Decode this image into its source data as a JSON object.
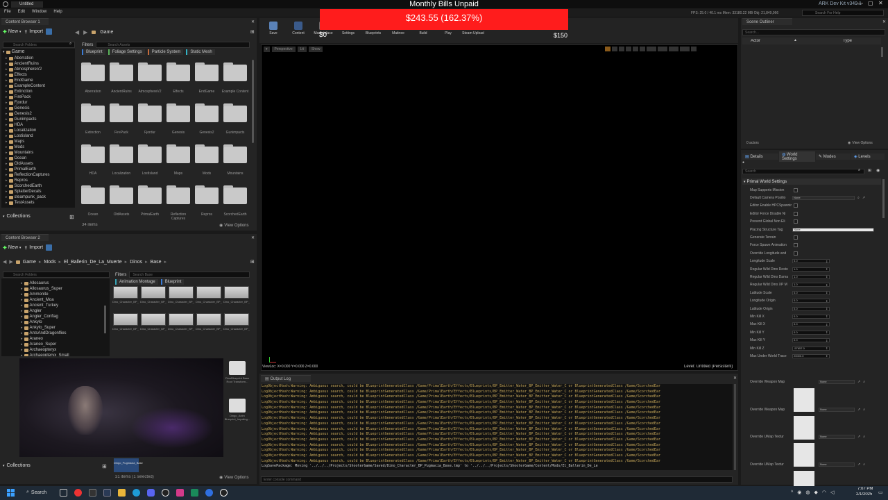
{
  "window": {
    "app_title": "Untitled",
    "menu": [
      "File",
      "Edit",
      "Window",
      "Help"
    ],
    "right_title": "ARK Dev Kit v349.1",
    "perf_text": "FPS: 25.0 / 40.1 ms  Mem: 33180.22 MB  Obj: 21,849,966",
    "help_placeholder": "Search For Help"
  },
  "bills_overlay": {
    "title": "Monthly Bills Unpaid",
    "amount": "$243.55 (162.37%)",
    "left_value": "$0",
    "right_value": "$150"
  },
  "toolbar": {
    "items": [
      "Save",
      "Content",
      "Marketplace",
      "Settings",
      "Blueprints",
      "Matinee",
      "Build",
      "Play",
      "Steam Upload"
    ]
  },
  "content_browser_1": {
    "tab": "Content Browser 1",
    "new_label": "New",
    "import_label": "Import",
    "path": "Game",
    "search_folders_placeholder": "Search Folders",
    "search_assets_placeholder": "Search Assets",
    "filters_label": "Filters",
    "filter_chips": [
      "Blueprint",
      "Foliage Settings",
      "Particle System",
      "Static Mesh"
    ],
    "tree_root": "Game",
    "tree": [
      "Aberration",
      "AncientRuins",
      "AtmosphereV2",
      "Effects",
      "EndGame",
      "ExampleContent",
      "Extinction",
      "FirePack",
      "Fjordur",
      "Genesis",
      "Genesis2",
      "Gunimpacts",
      "HDA",
      "Localization",
      "Lostisland",
      "Maps",
      "Mods",
      "Mountains",
      "Ocean",
      "OldAssets",
      "PrimalEarth",
      "ReflectionCaptures",
      "Repros",
      "ScorchedEarth",
      "SplatterDecals",
      "steampunk_pack",
      "TestAssets"
    ],
    "folders": [
      "Aberration",
      "AncientRuins",
      "AtmosphereV2",
      "Effects",
      "EndGame",
      "Example Content",
      "Extinction",
      "FirePack",
      "Fjordur",
      "Genesis",
      "Genesis2",
      "Gunimpacts",
      "HDA",
      "Localization",
      "LostIsland",
      "Maps",
      "Mods",
      "Mountains",
      "Ocean",
      "OldAssets",
      "PrimalEarth",
      "Reflection Captures",
      "Repros",
      "ScorchedEarth"
    ],
    "collections_label": "Collections",
    "items_count": "34 items",
    "view_options": "View Options"
  },
  "content_browser_2": {
    "tab": "Content Browser 2",
    "new_label": "New",
    "import_label": "Import",
    "path": [
      "Game",
      "Mods",
      "El_Ballerin_De_La_Muerte",
      "Dinos",
      "Base"
    ],
    "search_folders_placeholder": "Search Folders",
    "search_placeholder": "Search Base",
    "filters_label": "Filters",
    "filter_chips": [
      "Animation Montage",
      "Blueprint"
    ],
    "tree": [
      "Allosaurus",
      "Allosaurus_Super",
      "Ammonite",
      "Ancient_Moa",
      "Ancient_Turkey",
      "Angler",
      "Angler_Conflag",
      "Ankylo",
      "Ankylo_Super",
      "AntsAndDragonflies",
      "Araneo",
      "Araneo_Super",
      "Archaeopteryx",
      "Archaeopteryx_Small"
    ],
    "assets": [
      {
        "label": "Dino_Character_BP_Climber_..."
      },
      {
        "label": "Dino_Character_BP_Climber_..."
      },
      {
        "label": "Dino_Character_BP_DivingFlyer_..."
      },
      {
        "label": "Dino_Character_BP_HalfCurlable..."
      },
      {
        "label": "Dino_Character_BP_Nocturnal_..."
      },
      {
        "label": "Dino_Character_BP_Pack_Chupa..."
      },
      {
        "label": "Dino_Character_BP_Pack_pugmacia"
      },
      {
        "label": "Dino_Character_BP_Pugmacia"
      },
      {
        "label": "Dino_Character_BP_Pugmacia_Base"
      },
      {
        "label": "Dino_Character_BP_RepelFlyer_..."
      }
    ],
    "side_assets": [
      "DinoBlueprint Base Root Transform...",
      "Dingo_Anim Blueprint_Impaling..."
    ],
    "collections_label": "Collections",
    "items_count": "31 items (1 selected)",
    "view_options": "View Options",
    "selected_label": "Dingo_Pugmacia_Base"
  },
  "viewport": {
    "perspective_label": "Perspective",
    "lit_label": "Lit",
    "show_label": "Show",
    "viewloc": "ViewLoc: X=0.000 Y=0.000 Z=0.000",
    "level": "Level: Untitled (Persistent)"
  },
  "output_log": {
    "tab": "Output Log",
    "lines": [
      "LogObjectHash:Warning: Ambiguous search, could be BlueprintGeneratedClass /Game/PrimalEarth/Effects/Blueprints/BP_Emitter_Water_BP_Emitter_Water_C or BlueprintGeneratedClass /Game/ScorchedEar",
      "LogObjectHash:Warning: Ambiguous search, could be BlueprintGeneratedClass /Game/PrimalEarth/Effects/Blueprints/BP_Emitter_Water_BP_Emitter_Water_C or BlueprintGeneratedClass /Game/ScorchedEar",
      "LogObjectHash:Warning: Ambiguous search, could be BlueprintGeneratedClass /Game/PrimalEarth/Effects/Blueprints/BP_Emitter_Water_BP_Emitter_Water_C or BlueprintGeneratedClass /Game/ScorchedEar",
      "LogObjectHash:Warning: Ambiguous search, could be BlueprintGeneratedClass /Game/PrimalEarth/Effects/Blueprints/BP_Emitter_Water_BP_Emitter_Water_C or BlueprintGeneratedClass /Game/ScorchedEar",
      "LogObjectHash:Warning: Ambiguous search, could be BlueprintGeneratedClass /Game/PrimalEarth/Effects/Blueprints/BP_Emitter_Water_BP_Emitter_Water_C or BlueprintGeneratedClass /Game/ScorchedEar",
      "LogObjectHash:Warning: Ambiguous search, could be BlueprintGeneratedClass /Game/PrimalEarth/Effects/Blueprints/BP_Emitter_Water_BP_Emitter_Water_C or BlueprintGeneratedClass /Game/ScorchedEar",
      "LogObjectHash:Warning: Ambiguous search, could be BlueprintGeneratedClass /Game/PrimalEarth/Effects/Blueprints/BP_Emitter_Water_BP_Emitter_Water_C or BlueprintGeneratedClass /Game/ScorchedEar",
      "LogObjectHash:Warning: Ambiguous search, could be BlueprintGeneratedClass /Game/PrimalEarth/Effects/Blueprints/BP_Emitter_Water_BP_Emitter_Water_C or BlueprintGeneratedClass /Game/ScorchedEar",
      "LogObjectHash:Warning: Ambiguous search, could be BlueprintGeneratedClass /Game/PrimalEarth/Effects/Blueprints/BP_Emitter_Water_BP_Emitter_Water_C or BlueprintGeneratedClass /Game/ScorchedEar",
      "LogObjectHash:Warning: Ambiguous search, could be BlueprintGeneratedClass /Game/PrimalEarth/Effects/Blueprints/BP_Emitter_Water_BP_Emitter_Water_C or BlueprintGeneratedClass /Game/ScorchedEar",
      "LogObjectHash:Warning: Ambiguous search, could be BlueprintGeneratedClass /Game/PrimalEarth/Effects/Blueprints/BP_Emitter_Water_BP_Emitter_Water_C or BlueprintGeneratedClass /Game/ScorchedEar",
      "LogObjectHash:Warning: Ambiguous search, could be BlueprintGeneratedClass /Game/PrimalEarth/Effects/Blueprints/BP_Emitter_Water_BP_Emitter_Water_C or BlueprintGeneratedClass /Game/ScorchedEar",
      "LogObjectHash:Warning: Ambiguous search, could be BlueprintGeneratedClass /Game/PrimalEarth/Effects/Blueprints/BP_Emitter_Water_BP_Emitter_Water_C or BlueprintGeneratedClass /Game/ScorchedEar",
      "LogObjectHash:Warning: Ambiguous search, could be BlueprintGeneratedClass /Game/PrimalEarth/Effects/Blueprints/BP_Emitter_Water_BP_Emitter_Water_C or BlueprintGeneratedClass /Game/ScorchedEar",
      "LogObjectHash:Warning: Ambiguous search, could be BlueprintGeneratedClass /Game/PrimalEarth/Effects/Blueprints/BP_Emitter_Water_BP_Emitter_Water_C or BlueprintGeneratedClass /Game/ScorchedEar",
      "LogSavePackage: Moving '../../../Projects/ShooterGame/Saved/Dino_Character_BP_Pugmacia_Base.tmp' to '../../../Projects/ShooterGame/Content/Mods/El_Ballerin_De_Le"
    ],
    "console_placeholder": "Enter console command"
  },
  "outliner": {
    "tab": "Scene Outliner",
    "search_placeholder": "Search...",
    "col_actor": "Actor",
    "col_type": "Type",
    "count": "0 actors",
    "view_options": "View Options"
  },
  "details": {
    "tabs": [
      "Details",
      "World Settings",
      "Modes",
      "Levels"
    ],
    "search_placeholder": "Search",
    "section": "Primal World Settings",
    "checkbox_props": [
      "Map Supports Mission",
      "Editor Enable HPCSpawning",
      "Editor Force Disable Ni",
      "Prevent Global Non Eli",
      "Generate Terrain",
      "Force Spawn Animation",
      "Override Longitude and"
    ],
    "camera_prop": {
      "label": "Default Camera Positio",
      "value": "None"
    },
    "placing_prop": {
      "label": "Placing Structure Tag",
      "value": "None"
    },
    "numeric_props": [
      {
        "label": "Longitude Scale",
        "value": "0.0"
      },
      {
        "label": "Regular Wild Dino Resto",
        "value": "1.0"
      },
      {
        "label": "Regular Wild Dino Dama",
        "value": "1.0"
      },
      {
        "label": "Regular Wild Dino XP M",
        "value": "1.0"
      },
      {
        "label": "Latitude Scale",
        "value": "0.0"
      },
      {
        "label": "Longitude Origin",
        "value": "0.0"
      },
      {
        "label": "Latitude Origin",
        "value": "0.0"
      },
      {
        "label": "Min Kill X",
        "value": "0.0"
      },
      {
        "label": "Max Kill X",
        "value": "0.0"
      },
      {
        "label": "Min Kill Y",
        "value": "0.0"
      },
      {
        "label": "Max Kill Y",
        "value": "0.0"
      },
      {
        "label": "Min Kill Z",
        "value": "-57657.0"
      },
      {
        "label": "Max Under World Trace",
        "value": "20000.0"
      }
    ],
    "map_props": [
      {
        "label": "Override Weapon Map",
        "value": "None"
      },
      {
        "label": "Override Weapon Map",
        "value": "None"
      },
      {
        "label": "Override UMap Textur",
        "value": "None"
      },
      {
        "label": "Override UMap Textur",
        "value": "None"
      }
    ]
  },
  "taskbar": {
    "search_label": "Search",
    "time": "7:07 PM",
    "date": "2/1/2025"
  }
}
